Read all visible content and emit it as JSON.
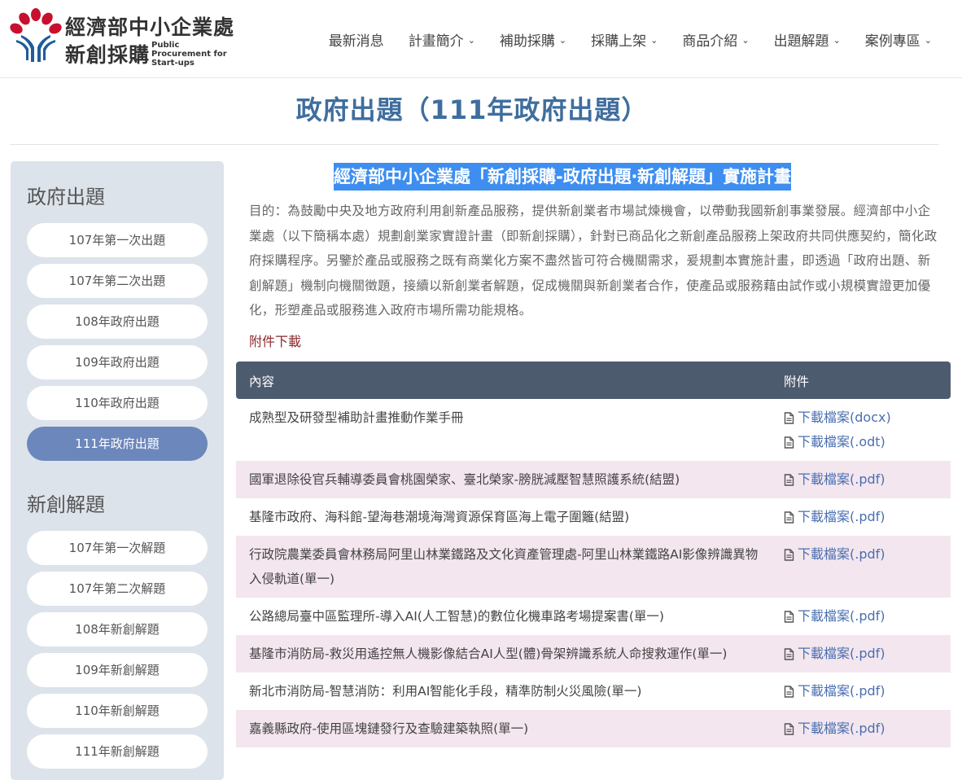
{
  "header": {
    "logo_cn_line1": "經濟部中小企業處",
    "logo_cn_line2": "新創採購",
    "logo_en": "Public Procurement for Start-ups",
    "nav": [
      {
        "label": "最新消息",
        "dropdown": false
      },
      {
        "label": "計畫簡介",
        "dropdown": true
      },
      {
        "label": "補助採購",
        "dropdown": true
      },
      {
        "label": "採購上架",
        "dropdown": true
      },
      {
        "label": "商品介紹",
        "dropdown": true
      },
      {
        "label": "出題解題",
        "dropdown": true
      },
      {
        "label": "案例專區",
        "dropdown": true
      }
    ]
  },
  "page_title": "政府出題（111年政府出題）",
  "sidebar": {
    "section1_title": "政府出題",
    "section1_items": [
      "107年第一次出題",
      "107年第二次出題",
      "108年政府出題",
      "109年政府出題",
      "110年政府出題",
      "111年政府出題"
    ],
    "section1_active": "111年政府出題",
    "section2_title": "新創解題",
    "section2_items": [
      "107年第一次解題",
      "107年第二次解題",
      "108年新創解題",
      "109年新創解題",
      "110年新創解題",
      "111年新創解題"
    ]
  },
  "main": {
    "doc_title": "經濟部中小企業處「新創採購-政府出題‧新創解題」實施計畫",
    "purpose": "目的：為鼓勵中央及地方政府利用創新產品服務，提供新創業者市場試煉機會，以帶動我國新創事業發展。經濟部中小企業處（以下簡稱本處）規劃創業家實證計畫（即新創採購），針對已商品化之新創產品服務上架政府共同供應契約，簡化政府採購程序。另鑒於產品或服務之既有商業化方案不盡然皆可符合機關需求，爰規劃本實施計畫，即透過「政府出題、新創解題」機制向機關徵題，接續以新創業者解題，促成機關與新創業者合作，使產品或服務藉由試作或小規模實證更加優化，形塑產品或服務進入政府市場所需功能規格。",
    "attachments_label": "附件下載",
    "table": {
      "col_content": "內容",
      "col_files": "附件",
      "rows": [
        {
          "content": "成熟型及研發型補助計畫推動作業手冊",
          "files": [
            "下載檔案(docx)",
            "下載檔案(.odt)"
          ]
        },
        {
          "content": "國軍退除役官兵輔導委員會桃園榮家、臺北榮家-膀胱減壓智慧照護系統(結盟)",
          "files": [
            "下載檔案(.pdf)"
          ]
        },
        {
          "content": "基隆市政府、海科館-望海巷潮境海灣資源保育區海上電子圍籬(結盟)",
          "files": [
            "下載檔案(.pdf)"
          ]
        },
        {
          "content": "行政院農業委員會林務局阿里山林業鐵路及文化資產管理處-阿里山林業鐵路AI影像辨識異物入侵軌道(單一)",
          "files": [
            "下載檔案(.pdf)"
          ]
        },
        {
          "content": "公路總局臺中區監理所-導入AI(人工智慧)的數位化機車路考場提案書(單一)",
          "files": [
            "下載檔案(.pdf)"
          ]
        },
        {
          "content": "基隆市消防局-救災用遙控無人機影像結合AI人型(體)骨架辨識系統人命搜救運作(單一)",
          "files": [
            "下載檔案(.pdf)"
          ]
        },
        {
          "content": "新北市消防局-智慧消防：利用AI智能化手段，精準防制火災風險(單一)",
          "files": [
            "下載檔案(.pdf)"
          ]
        },
        {
          "content": "嘉義縣政府-使用區塊鏈發行及查驗建築執照(單一)",
          "files": [
            "下載檔案(.pdf)"
          ]
        }
      ]
    }
  },
  "colors": {
    "title_blue": "#3f6e9e",
    "sidebar_bg": "#dde3ea",
    "active_btn": "#6c87bb",
    "table_header": "#4d5b6f",
    "row_alt": "#f3e6ee",
    "link_blue": "#4a6fb0",
    "attach_red": "#8b2a2a",
    "highlight": "#3d8ef0"
  },
  "icons": {
    "file": "file-text-icon",
    "chevron": "chevron-down-icon",
    "logo": "logo-icon"
  }
}
